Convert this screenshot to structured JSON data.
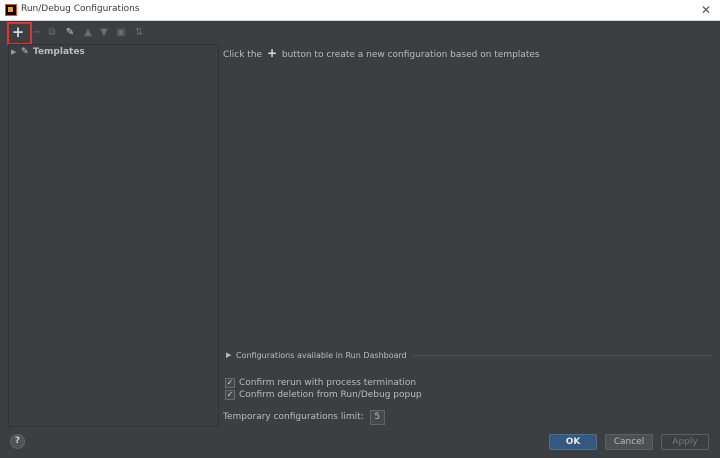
{
  "window": {
    "title": "Run/Debug Configurations",
    "close_glyph": "✕"
  },
  "toolbar": {
    "add": "+",
    "remove": "−",
    "copy": "⧉",
    "edit": "✎",
    "move_up": "▲",
    "move_down": "▼",
    "folder": "▣",
    "sort": "⇅"
  },
  "tree": {
    "arrow": "▶",
    "templates_icon": "✎",
    "templates_label": "Templates"
  },
  "main": {
    "hint_before": "Click the",
    "hint_plus": "+",
    "hint_after": "button to create a new configuration based on templates"
  },
  "dashboard": {
    "arrow": "▶",
    "label": "Configurations available in Run Dashboard"
  },
  "options": {
    "confirm_rerun": {
      "label": "Confirm rerun with process termination",
      "checked": "✓"
    },
    "confirm_deletion": {
      "label": "Confirm deletion from Run/Debug popup",
      "checked": "✓"
    },
    "limit_label": "Temporary configurations limit:",
    "limit_value": "5"
  },
  "footer": {
    "help": "?",
    "ok": "OK",
    "cancel": "Cancel",
    "apply": "Apply"
  },
  "colors": {
    "background": "#3c3f41",
    "accent": "#365880",
    "highlight": "#e03434"
  }
}
